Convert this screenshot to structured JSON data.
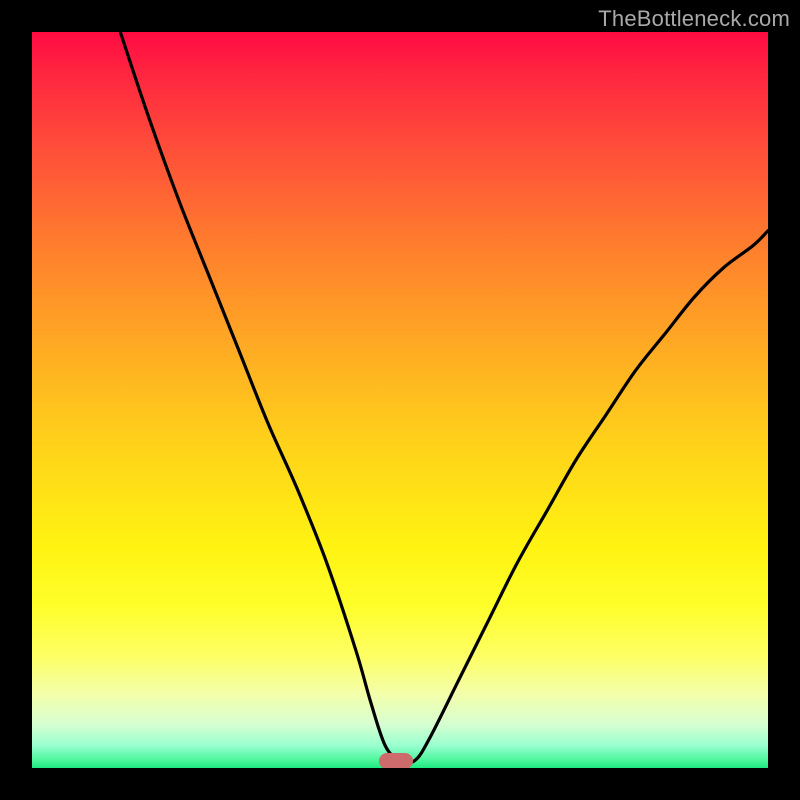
{
  "watermark": "TheBottleneck.com",
  "marker": {
    "x_pct": 49.5,
    "y_pct": 99.0,
    "color": "#cd6a6c"
  },
  "chart_data": {
    "type": "line",
    "title": "",
    "xlabel": "",
    "ylabel": "",
    "xlim": [
      0,
      100
    ],
    "ylim": [
      0,
      100
    ],
    "grid": false,
    "legend": false,
    "series": [
      {
        "name": "curve",
        "x": [
          12,
          16,
          20,
          24,
          28,
          32,
          36,
          40,
          44,
          46,
          48,
          50,
          52,
          54,
          58,
          62,
          66,
          70,
          74,
          78,
          82,
          86,
          90,
          94,
          98,
          100
        ],
        "y": [
          100,
          88,
          77,
          67,
          57,
          47,
          38,
          28,
          16,
          9,
          3,
          1,
          1,
          4,
          12,
          20,
          28,
          35,
          42,
          48,
          54,
          59,
          64,
          68,
          71,
          73
        ]
      }
    ],
    "annotations": [
      {
        "type": "marker",
        "shape": "pill",
        "x": 49.5,
        "y": 1.0,
        "color": "#cd6a6c"
      }
    ]
  }
}
